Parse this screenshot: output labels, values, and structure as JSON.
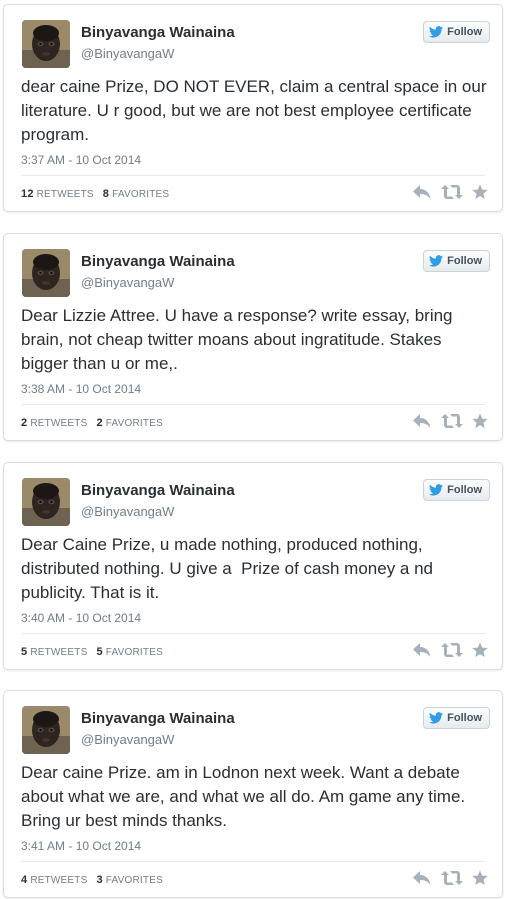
{
  "colors": {
    "action_icon": "#a6b1ba",
    "follow_bird": "#2f9ee6",
    "muted_text": "#707e88",
    "body_text": "#292f33"
  },
  "icons": {
    "reply": "reply-icon",
    "retweet": "retweet-icon",
    "favorite": "star-icon",
    "follow": "twitter-bird-icon"
  },
  "tweets": [
    {
      "name": "Binyavanga Wainaina",
      "handle": "@BinyavangaW",
      "follow_label": "Follow",
      "text": "dear caine Prize, DO NOT EVER, claim a central space in our literature. U r good, but we are not best employee certificate program.",
      "timestamp": "3:37 AM - 10 Oct 2014",
      "retweets": "12",
      "retweets_label": "RETWEETS",
      "favorites": "8",
      "favorites_label": "FAVORITES"
    },
    {
      "name": "Binyavanga Wainaina",
      "handle": "@BinyavangaW",
      "follow_label": "Follow",
      "text": "Dear Lizzie Attree. U have a response? write essay, bring brain, not cheap twitter moans about ingratitude. Stakes bigger than u or me,.",
      "timestamp": "3:38 AM - 10 Oct 2014",
      "retweets": "2",
      "retweets_label": "RETWEETS",
      "favorites": "2",
      "favorites_label": "FAVORITES"
    },
    {
      "name": "Binyavanga Wainaina",
      "handle": "@BinyavangaW",
      "follow_label": "Follow",
      "text": "Dear Caine Prize, u made nothing, produced nothing, distributed nothing. U give a  Prize of cash money a nd publicity. That is it.",
      "timestamp": "3:40 AM - 10 Oct 2014",
      "retweets": "5",
      "retweets_label": "RETWEETS",
      "favorites": "5",
      "favorites_label": "FAVORITES"
    },
    {
      "name": "Binyavanga Wainaina",
      "handle": "@BinyavangaW",
      "follow_label": "Follow",
      "text": "Dear caine Prize. am in Lodnon next week. Want a debate about what we are, and what we all do. Am game any time. Bring ur best minds thanks.",
      "timestamp": "3:41 AM - 10 Oct 2014",
      "retweets": "4",
      "retweets_label": "RETWEETS",
      "favorites": "3",
      "favorites_label": "FAVORITES"
    }
  ]
}
